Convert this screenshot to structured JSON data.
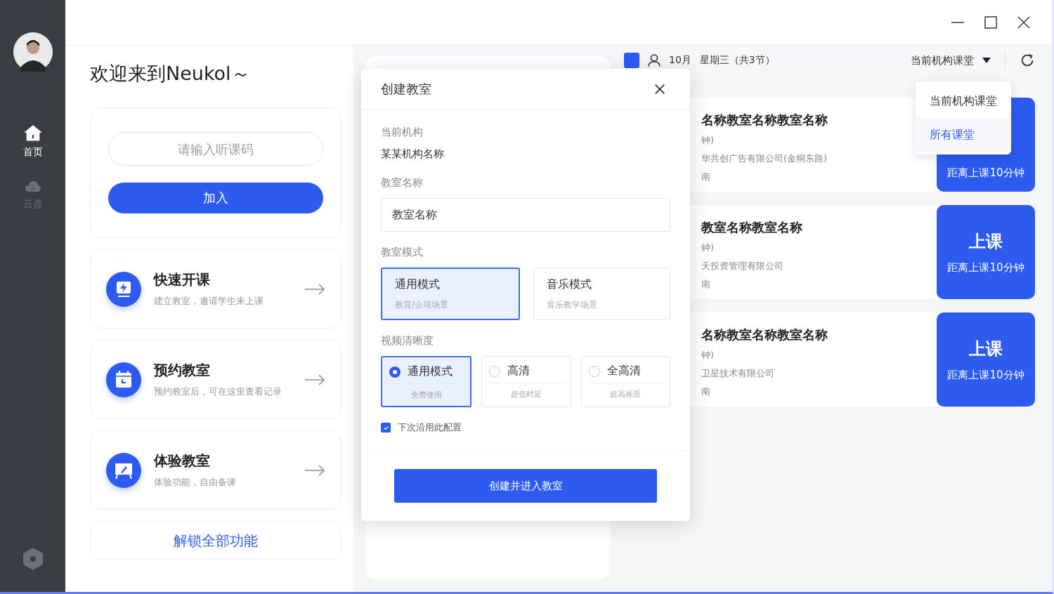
{
  "sidebar": {
    "items": [
      {
        "label": "首页",
        "selected": true
      },
      {
        "label": "云盘",
        "selected": false
      }
    ]
  },
  "welcome": {
    "title": "欢迎来到Neukol～"
  },
  "join": {
    "placeholder": "请输入听课码",
    "button": "加入"
  },
  "features": [
    {
      "title": "快速开课",
      "subtitle": "建立教室，邀请学生来上课"
    },
    {
      "title": "预约教室",
      "subtitle": "预约教室后，可在这里查看记录"
    },
    {
      "title": "体验教室",
      "subtitle": "体验功能，自由备课"
    }
  ],
  "unlock_link": "解锁全部功能",
  "schedule": {
    "date": "10月",
    "weekday": "星期三（共3节）",
    "filter": "当前机构课堂",
    "filter_menu": [
      {
        "label": "当前机构课堂",
        "selected": false
      },
      {
        "label": "所有课堂",
        "selected": true
      }
    ],
    "classes": [
      {
        "title": "名称教室名称教室名称",
        "duration": "钟)",
        "place": "华共创广告有限公司(金桐东路)",
        "note": "南",
        "action_subtitle": "距离上课10分钟"
      },
      {
        "title": "教室名称教室名称",
        "duration": "钟)",
        "place": "天投资管理有限公司",
        "note": "南",
        "action_title": "上课",
        "action_subtitle": "距离上课10分钟"
      },
      {
        "title": "名称教室名称教室名称",
        "duration": "钟)",
        "place": "卫星技术有限公司",
        "note": "南",
        "action_title": "上课",
        "action_subtitle": "距离上课10分钟"
      }
    ]
  },
  "dialog": {
    "title": "创建教室",
    "org_label": "当前机构",
    "org_value": "某某机构名称",
    "name_label": "教室名称",
    "name_value": "教室名称",
    "mode_label": "教室模式",
    "modes": [
      {
        "title": "通用模式",
        "subtitle": "教育/企培场景",
        "selected": true
      },
      {
        "title": "音乐模式",
        "subtitle": "音乐教学场景",
        "selected": false
      }
    ],
    "quality_label": "视频清晰度",
    "qualities": [
      {
        "title": "通用模式",
        "subtitle": "免费使用",
        "selected": true
      },
      {
        "title": "高清",
        "subtitle": "超低时延",
        "selected": false
      },
      {
        "title": "全高清",
        "subtitle": "超高画质",
        "selected": false
      }
    ],
    "remember": {
      "label": "下次沿用此配置",
      "checked": true
    },
    "submit": "创建并进入教室"
  }
}
